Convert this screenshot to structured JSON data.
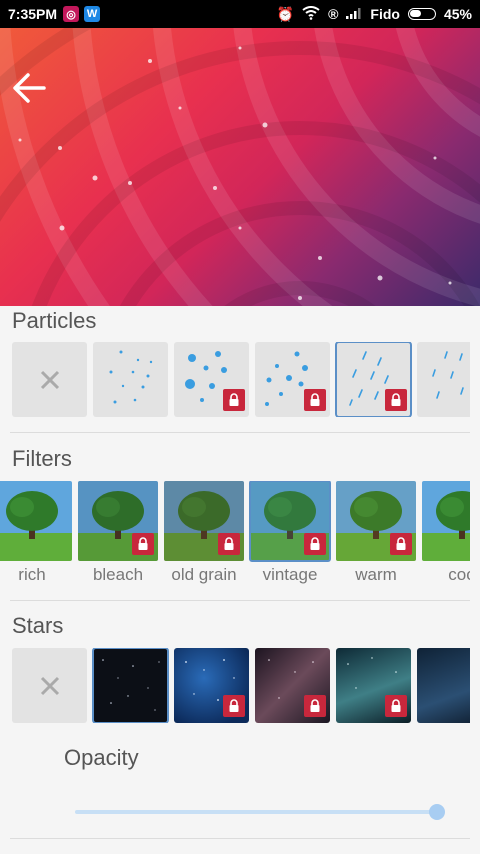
{
  "status_bar": {
    "time": "7:35PM",
    "carrier": "Fido",
    "battery_text": "45%",
    "battery_level": 0.45,
    "app_icons": [
      "instagram-icon",
      "word-icon"
    ]
  },
  "sections": {
    "particles": {
      "title": "Particles"
    },
    "filters": {
      "title": "Filters",
      "items": [
        {
          "label": "rich",
          "locked": false
        },
        {
          "label": "bleach",
          "locked": true
        },
        {
          "label": "old grain",
          "locked": true
        },
        {
          "label": "vintage",
          "locked": true,
          "selected": true
        },
        {
          "label": "warm",
          "locked": true
        },
        {
          "label": "coo",
          "locked": false
        }
      ]
    },
    "stars": {
      "title": "Stars"
    }
  },
  "opacity": {
    "label": "Opacity",
    "value": 1.0
  },
  "colors": {
    "accent": "#5b8fc7",
    "lock": "#c8273c",
    "particle": "#3a9de0"
  }
}
